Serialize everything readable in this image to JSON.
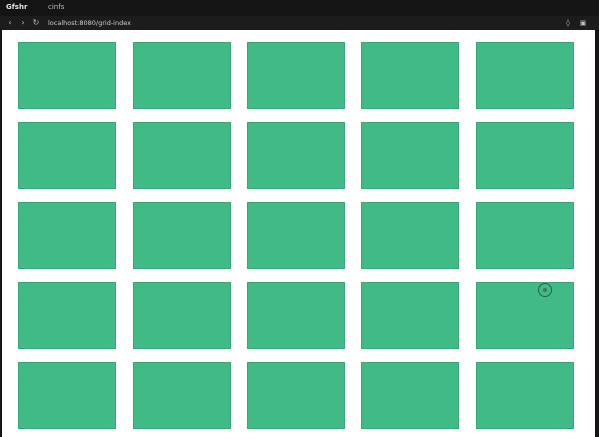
{
  "window": {
    "tab_title": "Gfshr",
    "tab_subtitle": "cinfs"
  },
  "toolbar": {
    "back_icon": "back-arrow-icon",
    "forward_icon": "forward-arrow-icon",
    "reload_icon": "reload-icon",
    "url": "localhost:8080/grid-index",
    "right_icons": [
      "extensions-icon",
      "sidebar-icon"
    ]
  },
  "page": {
    "tile_color": "#41bb86",
    "background": "#ffffff",
    "rows": [
      [
        "",
        "",
        "",
        "",
        ""
      ],
      [
        "",
        "",
        "",
        "",
        ""
      ],
      [
        "",
        "",
        "",
        "",
        ""
      ],
      [
        "",
        "",
        "",
        "",
        ""
      ],
      [
        "",
        "",
        "",
        "",
        ""
      ]
    ]
  }
}
